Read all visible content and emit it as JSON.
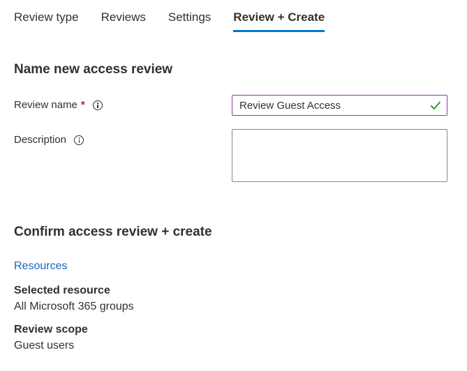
{
  "tabs": [
    {
      "label": "Review type",
      "active": false
    },
    {
      "label": "Reviews",
      "active": false
    },
    {
      "label": "Settings",
      "active": false
    },
    {
      "label": "Review + Create",
      "active": true
    }
  ],
  "name_section": {
    "title": "Name new access review",
    "review_name": {
      "label": "Review name",
      "required_marker": "*",
      "info_icon": "info-icon",
      "value": "Review Guest Access",
      "validation_icon": "checkmark-icon",
      "validation_color": "#107c10"
    },
    "description": {
      "label": "Description",
      "info_icon": "info-icon",
      "value": ""
    }
  },
  "confirm_section": {
    "title": "Confirm access review + create",
    "resources_link": "Resources",
    "selected_resource": {
      "label": "Selected resource",
      "value": "All Microsoft 365 groups"
    },
    "review_scope": {
      "label": "Review scope",
      "value": "Guest users"
    }
  },
  "colors": {
    "accent": "#0078d4",
    "link": "#0f6cbd",
    "input_border_focus": "#8a3b9e",
    "required": "#a4262c",
    "text": "#323130"
  }
}
